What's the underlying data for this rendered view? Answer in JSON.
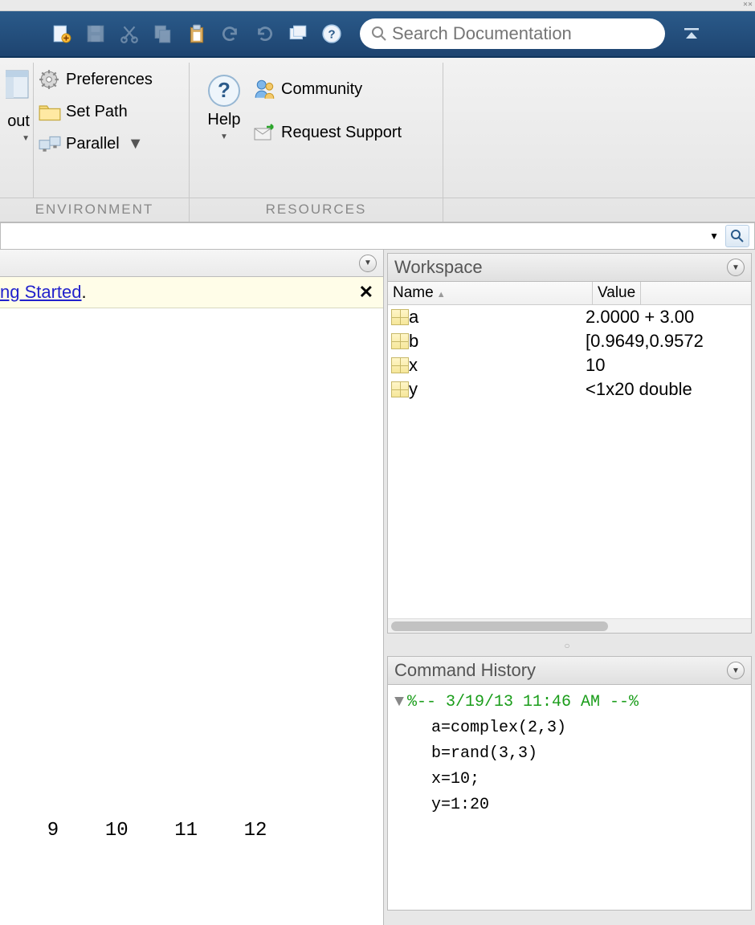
{
  "search": {
    "placeholder": "Search Documentation"
  },
  "ribbon": {
    "layout_label": "out",
    "env": {
      "preferences": "Preferences",
      "set_path": "Set Path",
      "parallel": "Parallel"
    },
    "help_label": "Help",
    "community": "Community",
    "request_support": "Request Support",
    "section_env": "ENVIRONMENT",
    "section_res": "RESOURCES"
  },
  "banner": {
    "link_text": "ng Started",
    "suffix": "."
  },
  "command_numbers": "  9    10    11    12",
  "workspace": {
    "title": "Workspace",
    "col_name": "Name",
    "col_value": "Value",
    "vars": [
      {
        "name": "a",
        "value": "2.0000 + 3.00"
      },
      {
        "name": "b",
        "value": "[0.9649,0.9572"
      },
      {
        "name": "x",
        "value": "10"
      },
      {
        "name": "y",
        "value": "<1x20 double"
      }
    ]
  },
  "history": {
    "title": "Command History",
    "timestamp": "%-- 3/19/13 11:46 AM --%",
    "cmds": [
      "a=complex(2,3)",
      "b=rand(3,3)",
      "x=10;",
      "y=1:20"
    ]
  }
}
